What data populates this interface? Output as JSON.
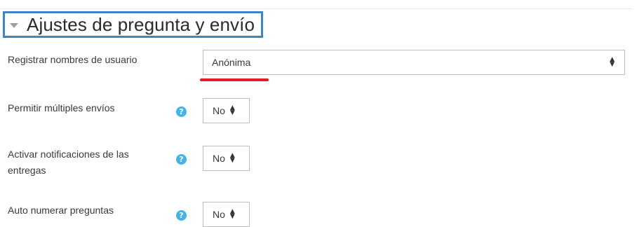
{
  "section": {
    "title": "Ajustes de pregunta y envío"
  },
  "fields": {
    "usernames": {
      "label": "Registrar nombres de usuario",
      "value": "Anónima"
    },
    "multiple": {
      "label": "Permitir múltiples envíos",
      "value": "No"
    },
    "notifications": {
      "label": "Activar notificaciones de las entregas",
      "value": "No"
    },
    "autonumber": {
      "label": "Auto numerar preguntas",
      "value": "No"
    }
  },
  "help_glyph": "?",
  "colors": {
    "header_border": "#3c86c8",
    "help_icon": "#44b3e6",
    "annotation_underline": "#e51b24"
  }
}
